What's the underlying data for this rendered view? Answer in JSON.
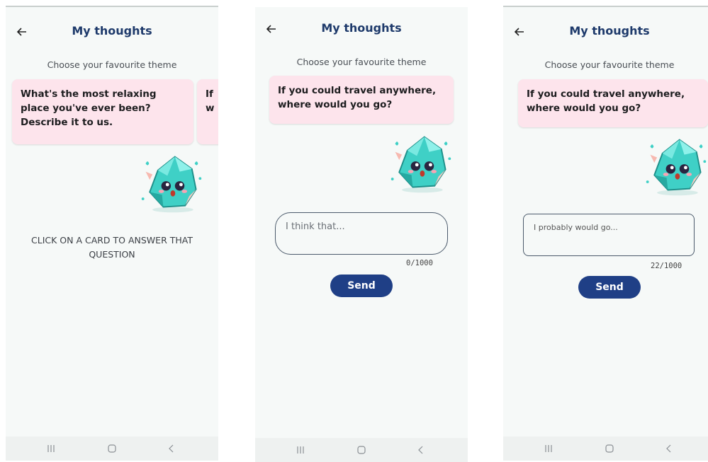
{
  "screens": [
    {
      "title": "My thoughts",
      "subtitle": "Choose your favourite theme",
      "card_text": "What's the most relaxing place you've ever been? Describe it to us.",
      "peek_card_text": "If w",
      "hint": "CLICK ON A CARD TO ANSWER THAT QUESTION"
    },
    {
      "title": "My thoughts",
      "subtitle": "Choose your favourite theme",
      "card_text": "If you could travel anywhere, where would you go?",
      "placeholder": "I think that...",
      "counter": "0/1000",
      "send": "Send"
    },
    {
      "title": "My thoughts",
      "subtitle": "Choose your favourite theme",
      "card_text": "If you could travel anywhere, where would you go?",
      "answer_value": "I probably would go...",
      "counter": "22/1000",
      "send": "Send"
    }
  ],
  "colors": {
    "title": "#1e3a6b",
    "card_bg": "#fde4ec",
    "send_bg": "#1f3f86",
    "screen_bg": "#f6f9f8"
  },
  "icons": [
    "back-arrow-icon",
    "crystal-mascot-icon",
    "recents-icon",
    "home-icon",
    "back-nav-icon"
  ]
}
